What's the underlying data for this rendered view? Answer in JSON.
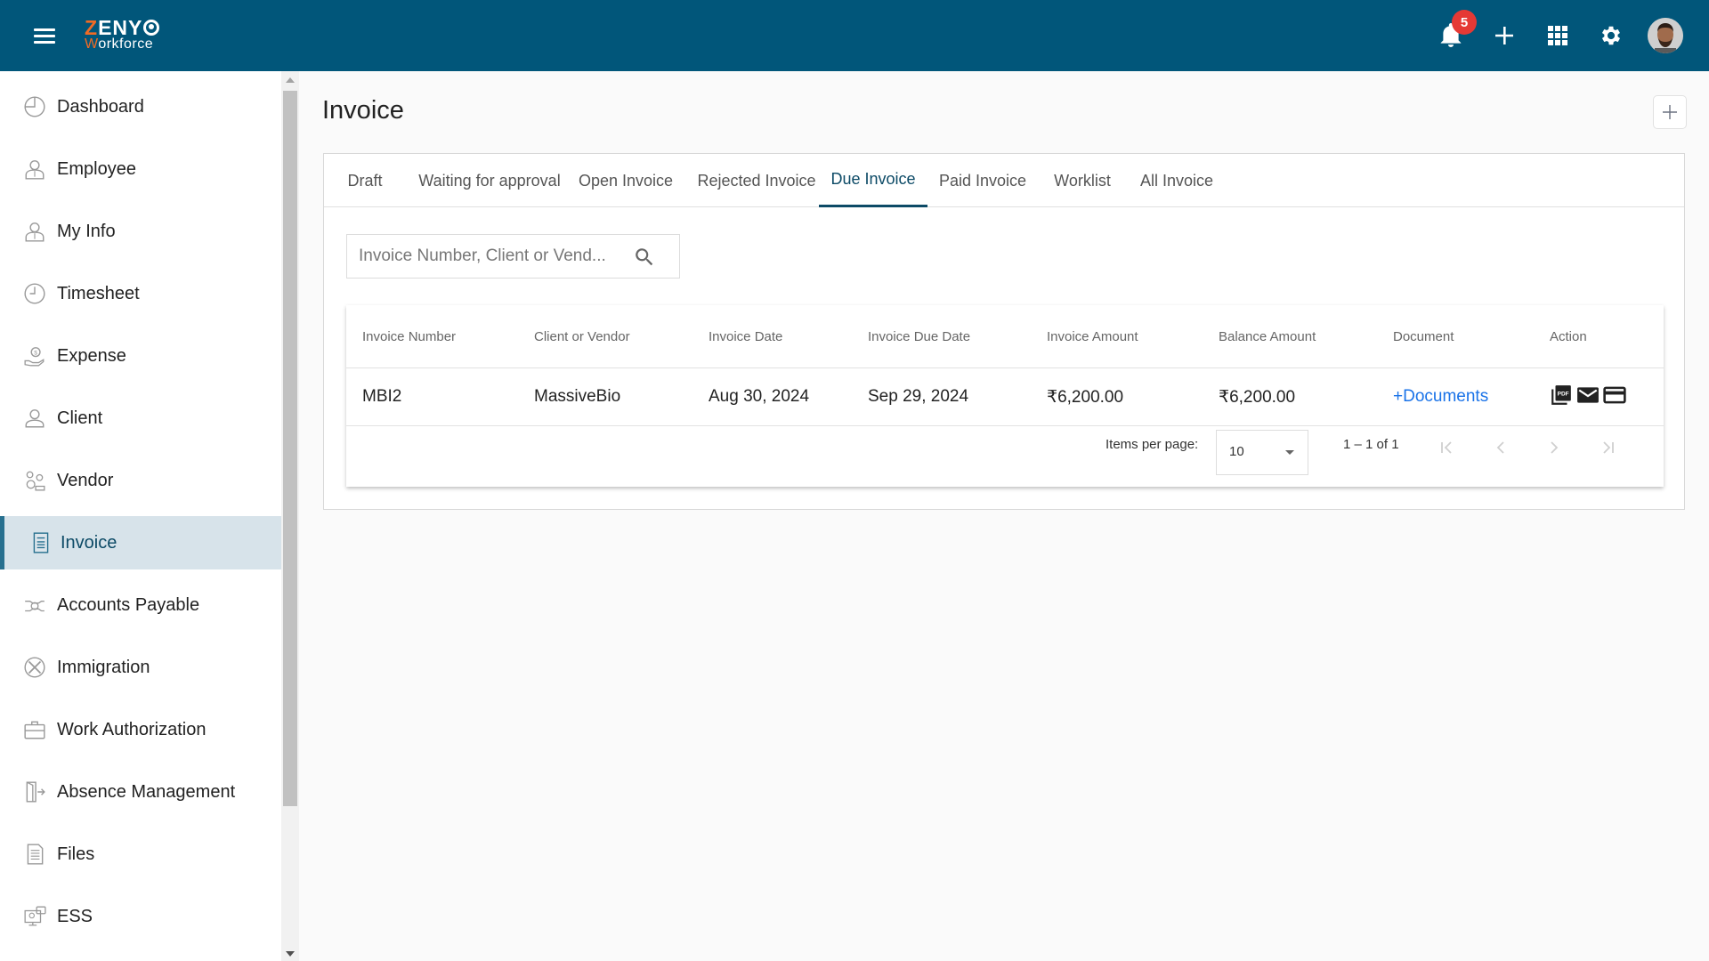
{
  "header": {
    "brand_line1_accent": "Z",
    "brand_line1_rest": "ENY",
    "brand_line2_accent": "W",
    "brand_line2_rest": "orkforce",
    "notifications_count": "5",
    "icons": [
      "menu-icon",
      "bell-icon",
      "plus-icon",
      "apps-grid-icon",
      "gear-icon",
      "avatar"
    ],
    "brand_color": "#01567a",
    "accent_color": "#f06b25",
    "badge_color": "#e53935"
  },
  "sidebar": {
    "active_index": 7,
    "items": [
      {
        "label": "Dashboard",
        "icon": "dashboard-icon"
      },
      {
        "label": "Employee",
        "icon": "employee-icon"
      },
      {
        "label": "My Info",
        "icon": "my-info-icon"
      },
      {
        "label": "Timesheet",
        "icon": "clock-icon"
      },
      {
        "label": "Expense",
        "icon": "expense-icon"
      },
      {
        "label": "Client",
        "icon": "client-icon"
      },
      {
        "label": "Vendor",
        "icon": "vendor-icon"
      },
      {
        "label": "Invoice",
        "icon": "invoice-icon"
      },
      {
        "label": "Accounts Payable",
        "icon": "accounts-payable-icon"
      },
      {
        "label": "Immigration",
        "icon": "immigration-icon"
      },
      {
        "label": "Work Authorization",
        "icon": "briefcase-icon"
      },
      {
        "label": "Absence Management",
        "icon": "door-exit-icon"
      },
      {
        "label": "Files",
        "icon": "file-icon"
      },
      {
        "label": "ESS",
        "icon": "ess-icon"
      }
    ]
  },
  "main": {
    "title": "Invoice",
    "tabs": [
      {
        "label": "Draft"
      },
      {
        "label": "Waiting for approval"
      },
      {
        "label": "Open Invoice"
      },
      {
        "label": "Rejected Invoice"
      },
      {
        "label": "Due Invoice",
        "active": true
      },
      {
        "label": "Paid Invoice"
      },
      {
        "label": "Worklist"
      },
      {
        "label": "All Invoice"
      }
    ],
    "search": {
      "placeholder": "Invoice Number, Client or Vend...",
      "value": ""
    },
    "table": {
      "columns": [
        "Invoice Number",
        "Client or Vendor",
        "Invoice Date",
        "Invoice Due Date",
        "Invoice Amount",
        "Balance Amount",
        "Document",
        "Action"
      ],
      "rows": [
        {
          "invoice_number": "MBI2",
          "client_or_vendor": "MassiveBio",
          "invoice_date": "Aug 30, 2024",
          "invoice_due_date": "Sep 29, 2024",
          "invoice_amount": "₹6,200.00",
          "balance_amount": "₹6,200.00",
          "document": "+Documents",
          "actions": [
            "pdf-icon",
            "email-icon",
            "payment-card-icon"
          ]
        }
      ]
    },
    "paginator": {
      "items_per_page_label": "Items per page:",
      "items_per_page": "10",
      "range": "1 – 1 of 1"
    }
  }
}
